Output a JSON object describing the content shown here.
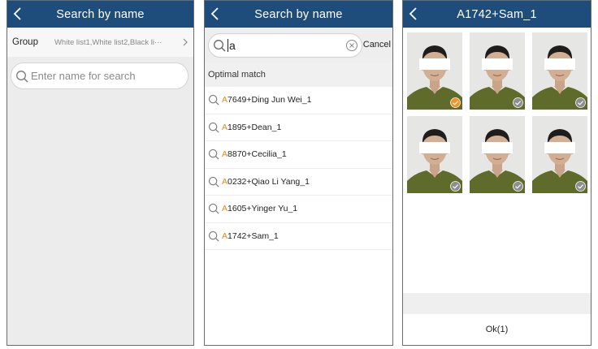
{
  "screen1": {
    "title": "Search by name",
    "group_label": "Group",
    "group_value": "White list1,White list2,Black li···",
    "search_placeholder": "Enter name for search"
  },
  "screen2": {
    "title": "Search by name",
    "query": "a",
    "cancel_label": "Cancel",
    "section_header": "Optimal match",
    "results": [
      {
        "prefix": "A",
        "rest": "7649+Ding Jun Wei_1"
      },
      {
        "prefix": "A",
        "rest": "1895+Dean_1"
      },
      {
        "prefix": "A",
        "rest": "8870+Cecilia_1"
      },
      {
        "prefix": "A",
        "rest": "0232+Qiao Li Yang_1"
      },
      {
        "prefix": "A",
        "rest": "1605+Yinger Yu_1"
      },
      {
        "prefix": "A",
        "rest": "1742+Sam_1"
      }
    ]
  },
  "screen3": {
    "title": "A1742+Sam_1",
    "photos_selected": [
      true,
      false,
      false,
      false,
      false,
      false
    ],
    "ok_label": "Ok(1)"
  },
  "colors": {
    "titlebar": "#1e4d7c",
    "highlight": "#e38a1e",
    "check_selected": "#f0952a",
    "check_unselected": "#8e8e8e"
  },
  "icons": {
    "back": "back-chevron-icon",
    "search": "magnifier-icon",
    "clear": "clear-circle-icon",
    "chevron": "chevron-right-icon",
    "check": "checkmark-circle-icon"
  }
}
